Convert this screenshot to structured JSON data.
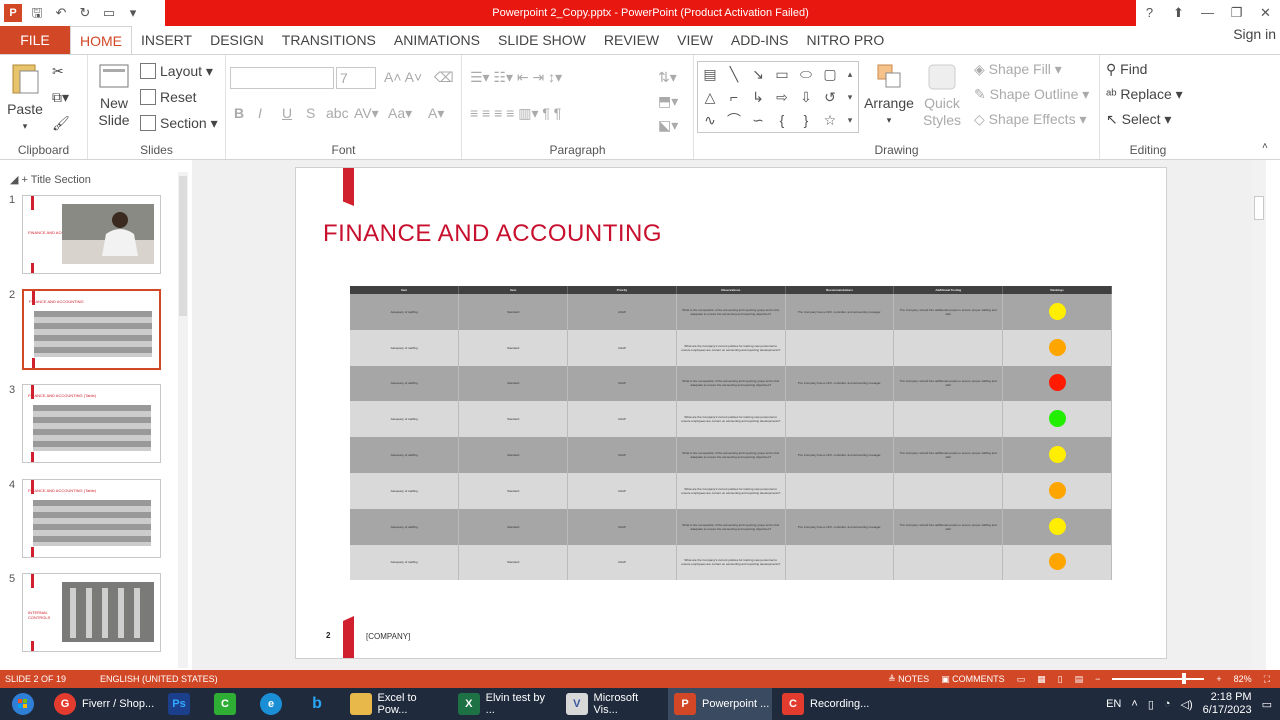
{
  "window": {
    "title": "Powerpoint 2_Copy.pptx -  PowerPoint (Product Activation Failed)",
    "app_icon": "P",
    "controls": [
      "?",
      "⬆",
      "—",
      "❐",
      "✕"
    ]
  },
  "tabs": [
    "FILE",
    "HOME",
    "INSERT",
    "DESIGN",
    "TRANSITIONS",
    "ANIMATIONS",
    "SLIDE SHOW",
    "REVIEW",
    "VIEW",
    "ADD-INS",
    "NITRO PRO"
  ],
  "signin": "Sign in",
  "ribbon": {
    "clipboard": {
      "label": "Clipboard",
      "paste": "Paste"
    },
    "slides": {
      "label": "Slides",
      "new_slide": "New Slide",
      "layout": "Layout",
      "reset": "Reset",
      "section": "Section"
    },
    "font": {
      "label": "Font",
      "size": "7"
    },
    "paragraph": {
      "label": "Paragraph"
    },
    "drawing": {
      "label": "Drawing",
      "arrange": "Arrange",
      "quick_styles": "Quick Styles",
      "shape_fill": "Shape Fill",
      "shape_outline": "Shape Outline",
      "shape_effects": "Shape Effects"
    },
    "editing": {
      "label": "Editing",
      "find": "Find",
      "replace": "Replace",
      "select": "Select"
    }
  },
  "panel": {
    "section_title": "Title Section",
    "thumbs": [
      {
        "num": "1",
        "title": "FINANCE AND ACCOUNTING"
      },
      {
        "num": "2",
        "title": "FINANCE AND ACCOUNTING"
      },
      {
        "num": "3",
        "title": "FINANCE AND ACCOUNTING (Table)"
      },
      {
        "num": "4",
        "title": "FINANCE AND ACCOUNTING (Table)"
      },
      {
        "num": "5",
        "title": "INTERNAL CONTROLS"
      }
    ]
  },
  "slide": {
    "title": "FINANCE AND ACCOUNTING",
    "page_number": "2",
    "company": "[COMPANY]",
    "table": {
      "headers": [
        "Item",
        "Item",
        "Priority",
        "Observations",
        "Recommendations",
        "Additional Testing",
        "Rankings"
      ],
      "rows": [
        {
          "c1": "Adequacy of staffing",
          "c2": "Standard",
          "c3": "ASAP",
          "c4": "What is the composition of the accounting and reporting group and is this adequate to ensure the accounting and reporting objectives?",
          "c5": "The Company has a CFO, controller, and accounting manager.",
          "c6": "The Company should hire additional people to ensure proper staffing and skill.",
          "color": "#ffee00",
          "shade": "dk"
        },
        {
          "c1": "Adequacy of staffing",
          "c2": "Standard",
          "c3": "ASAP",
          "c4": "What are the Company's current policies for training new personnel to ensure employees are current on accounting and reporting developments?",
          "c5": "",
          "c6": "",
          "color": "#ffa500",
          "shade": "lt"
        },
        {
          "c1": "Adequacy of staffing",
          "c2": "Standard",
          "c3": "ASAP",
          "c4": "What is the composition of the accounting and reporting group and is this adequate to ensure the accounting and reporting objectives?",
          "c5": "The Company has a CFO, controller, and accounting manager.",
          "c6": "The Company should hire additional people to ensure proper staffing and skill.",
          "color": "#ff1a00",
          "shade": "dk"
        },
        {
          "c1": "Adequacy of staffing",
          "c2": "Standard",
          "c3": "ASAP",
          "c4": "What are the Company's current policies for training new personnel to ensure employees are current on accounting and reporting developments?",
          "c5": "",
          "c6": "",
          "color": "#22ee00",
          "shade": "lt"
        },
        {
          "c1": "Adequacy of staffing",
          "c2": "Standard",
          "c3": "ASAP",
          "c4": "What is the composition of the accounting and reporting group and is this adequate to ensure the accounting and reporting objectives?",
          "c5": "The Company has a CFO, controller, and accounting manager.",
          "c6": "The Company should hire additional people to ensure proper staffing and skill.",
          "color": "#ffee00",
          "shade": "dk"
        },
        {
          "c1": "Adequacy of staffing",
          "c2": "Standard",
          "c3": "ASAP",
          "c4": "What are the Company's current policies for training new personnel to ensure employees are current on accounting and reporting developments?",
          "c5": "",
          "c6": "",
          "color": "#ffa500",
          "shade": "lt"
        },
        {
          "c1": "Adequacy of staffing",
          "c2": "Standard",
          "c3": "ASAP",
          "c4": "What is the composition of the accounting and reporting group and is this adequate to ensure the accounting and reporting objectives?",
          "c5": "The Company has a CFO, controller, and accounting manager.",
          "c6": "The Company should hire additional people to ensure proper staffing and skill.",
          "color": "#ffee00",
          "shade": "dk"
        },
        {
          "c1": "Adequacy of staffing",
          "c2": "Standard",
          "c3": "ASAP",
          "c4": "What are the Company's current policies for training new personnel to ensure employees are current on accounting and reporting developments?",
          "c5": "",
          "c6": "",
          "color": "#ffa500",
          "shade": "lt"
        }
      ]
    }
  },
  "status": {
    "slide_info": "SLIDE 2 OF 19",
    "language": "ENGLISH (UNITED STATES)",
    "notes": "NOTES",
    "comments": "COMMENTS",
    "zoom": "82%"
  },
  "taskbar": {
    "items": [
      {
        "label": "Fiverr / Shop...",
        "icon_color": "#e33b2e",
        "icon": "G"
      },
      {
        "label": "",
        "icon_color": "#1c3f8c",
        "icon": "Ps"
      },
      {
        "label": "",
        "icon_color": "#2fae36",
        "icon": "C"
      },
      {
        "label": "",
        "icon_color": "#1b8fd6",
        "icon": "e"
      },
      {
        "label": "",
        "icon_color": "#1f2b3d",
        "icon": "b"
      },
      {
        "label": "Excel to Pow...",
        "icon_color": "#e8b84a",
        "icon": "▮"
      },
      {
        "label": "Elvin test by ...",
        "icon_color": "#1e7145",
        "icon": "X"
      },
      {
        "label": "Microsoft Vis...",
        "icon_color": "#d8d8d8",
        "icon": "V"
      },
      {
        "label": "Powerpoint ...",
        "icon_color": "#d24726",
        "icon": "P"
      },
      {
        "label": "Recording...",
        "icon_color": "#e33b2e",
        "icon": "C"
      }
    ],
    "lang": "EN",
    "time": "2:18 PM",
    "date": "6/17/2023"
  }
}
